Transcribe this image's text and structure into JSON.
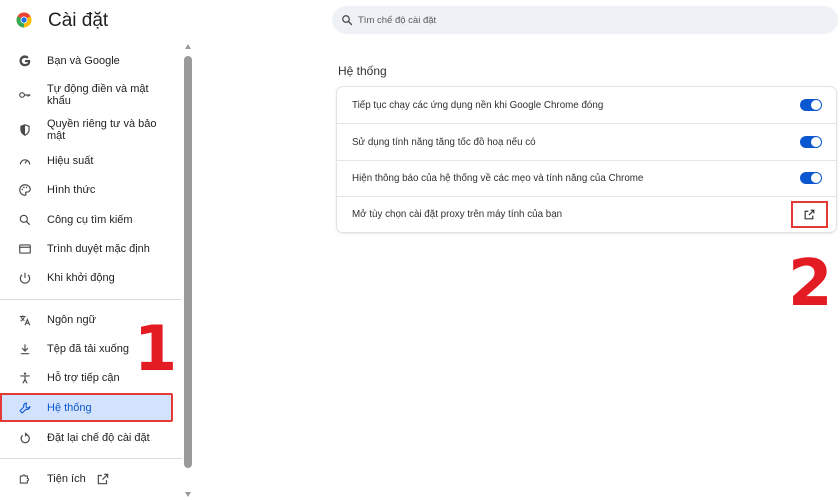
{
  "header": {
    "title": "Cài đặt",
    "search_placeholder": "Tìm chế độ cài đặt"
  },
  "sidebar": {
    "items": [
      {
        "label": "Bạn và Google",
        "icon": "google-g-icon"
      },
      {
        "label": "Tự động điền và mật khẩu",
        "icon": "key-icon"
      },
      {
        "label": "Quyền riêng tư và bảo mật",
        "icon": "shield-icon"
      },
      {
        "label": "Hiệu suất",
        "icon": "speedometer-icon"
      },
      {
        "label": "Hình thức",
        "icon": "palette-icon"
      },
      {
        "label": "Công cụ tìm kiếm",
        "icon": "search-icon"
      },
      {
        "label": "Trình duyệt mặc định",
        "icon": "browser-icon"
      },
      {
        "label": "Khi khởi động",
        "icon": "power-icon"
      },
      {
        "label": "Ngôn ngữ",
        "icon": "translate-icon"
      },
      {
        "label": "Tệp đã tải xuống",
        "icon": "download-icon"
      },
      {
        "label": "Hỗ trợ tiếp cận",
        "icon": "accessibility-icon"
      },
      {
        "label": "Hệ thống",
        "icon": "wrench-icon",
        "active": true
      },
      {
        "label": "Đặt lại chế độ cài đặt",
        "icon": "reset-icon"
      },
      {
        "label": "Tiện ích",
        "icon": "puzzle-icon"
      }
    ]
  },
  "annotations": {
    "step1": "1",
    "step2": "2"
  },
  "main": {
    "section_title": "Hệ thống",
    "rows": [
      {
        "label": "Tiếp tục chạy các ứng dụng nền khi Google Chrome đóng",
        "toggle": true
      },
      {
        "label": "Sử dụng tính năng tăng tốc đồ hoạ nếu có",
        "toggle": true
      },
      {
        "label": "Hiện thông báo của hệ thống về các mẹo và tính năng của Chrome",
        "toggle": true
      },
      {
        "label": "Mở tùy chọn cài đặt proxy trên máy tính của bạn",
        "action": "open-external-icon"
      }
    ]
  },
  "colors": {
    "accent": "#0b57d0",
    "active_bg": "#d3e3fd",
    "highlight": "#e53935",
    "annotation": "#e31b23"
  }
}
